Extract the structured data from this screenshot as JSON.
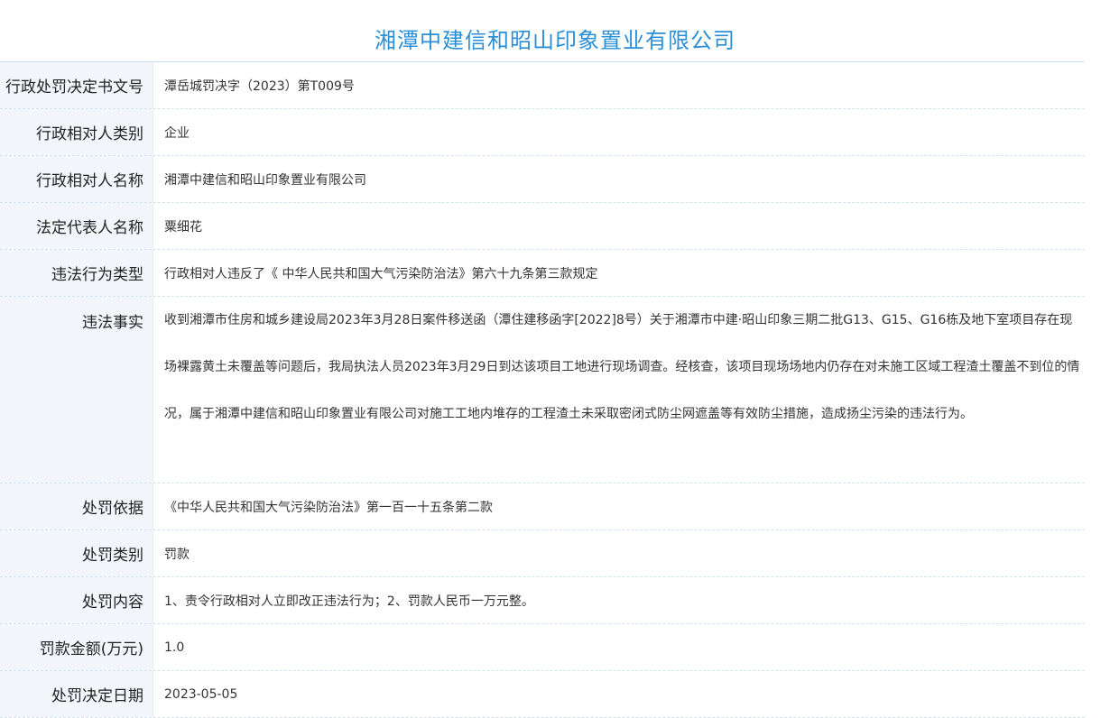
{
  "page_title": "湘潭中建信和昭山印象置业有限公司",
  "rows": [
    {
      "label": "行政处罚决定书文号",
      "value": "潭岳城罚决字（2023）第T009号"
    },
    {
      "label": "行政相对人类别",
      "value": "企业"
    },
    {
      "label": "行政相对人名称",
      "value": "湘潭中建信和昭山印象置业有限公司"
    },
    {
      "label": "法定代表人名称",
      "value": "粟细花"
    },
    {
      "label": "违法行为类型",
      "value": "行政相对人违反了《 中华人民共和国大气污染防治法》第六十九条第三款规定"
    },
    {
      "label": "违法事实",
      "value": "收到湘潭市住房和城乡建设局2023年3月28日案件移送函（潭住建移函字[2022]8号）关于湘潭市中建·昭山印象三期二批G13、G15、G16栋及地下室项目存在现场裸露黄土未覆盖等问题后，我局执法人员2023年3月29日到达该项目工地进行现场调查。经核查，该项目现场场地内仍存在对未施工区域工程渣土覆盖不到位的情况，属于湘潭中建信和昭山印象置业有限公司对施工工地内堆存的工程渣土未采取密闭式防尘网遮盖等有效防尘措施，造成扬尘污染的违法行为。"
    },
    {
      "label": "处罚依据",
      "value": "《中华人民共和国大气污染防治法》第一百一十五条第二款"
    },
    {
      "label": "处罚类别",
      "value": "罚款"
    },
    {
      "label": "处罚内容",
      "value": "1、责令行政相对人立即改正违法行为；2、罚款人民币一万元整。"
    },
    {
      "label": "罚款金额(万元)",
      "value": "1.0"
    },
    {
      "label": "处罚决定日期",
      "value": "2023-05-05"
    }
  ]
}
